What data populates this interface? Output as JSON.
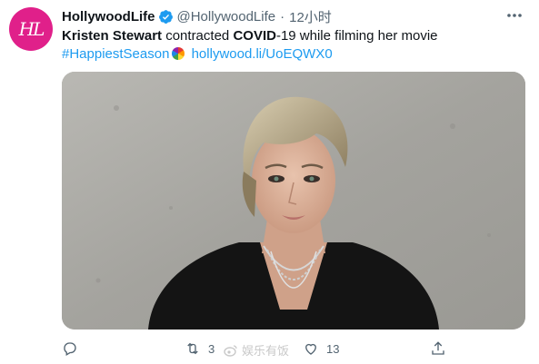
{
  "author": {
    "display_name": "HollywoodLife",
    "handle": "@HollywoodLife",
    "separator": "·",
    "time": "12小时",
    "avatar_text": "HL",
    "avatar_color": "#e0208a",
    "verified": true
  },
  "tweet": {
    "name_bold": "Kristen Stewart",
    "text_1": " contracted ",
    "covid_bold": "COVID",
    "text_2": "-19 while filming her movie",
    "hashtag": "#HappiestSeason",
    "emoji": "rainbow-ball-emoji",
    "link": "hollywood.li/UoEQWX0"
  },
  "actions": {
    "reply_count": "",
    "retweet_count": "3",
    "like_count": "13"
  },
  "watermark": {
    "text": "娱乐有饭"
  },
  "colors": {
    "link": "#1d9bf0",
    "muted": "#536471",
    "verified": "#1d9bf0"
  }
}
